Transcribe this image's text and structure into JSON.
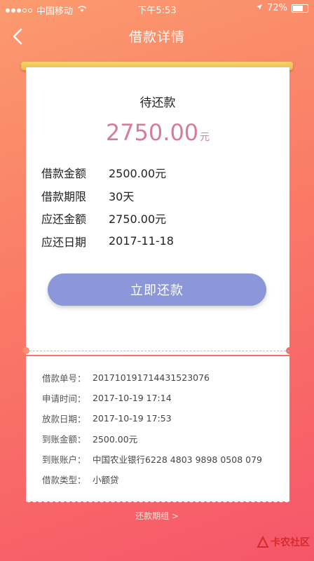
{
  "status_bar": {
    "carrier": "中国移动",
    "time": "下午5:53",
    "battery": "72%"
  },
  "nav": {
    "title": "借款详情"
  },
  "loan": {
    "status": "待还款",
    "amount": "2750.00",
    "amount_unit": "元",
    "rows": [
      {
        "label": "借款金额",
        "value": "2500.00元"
      },
      {
        "label": "借款期限",
        "value": "30天"
      },
      {
        "label": "应还金额",
        "value": "2750.00元"
      },
      {
        "label": "应还日期",
        "value": "2017-11-18"
      }
    ],
    "repay_button": "立即还款"
  },
  "details": [
    {
      "label": "借款单号：",
      "value": "201710191714431523076"
    },
    {
      "label": "申请时间：",
      "value": "2017-10-19 17:14"
    },
    {
      "label": "放款日期：",
      "value": "2017-10-19 17:53"
    },
    {
      "label": "到账金额：",
      "value": "2500.00元"
    },
    {
      "label": "到账账户：",
      "value": "中国农业银行6228 4803 9898 0508 079"
    },
    {
      "label": "借款类型：",
      "value": "小额贷"
    }
  ],
  "footer": {
    "plan_link": "还款期组 >",
    "watermark": "卡农社区"
  },
  "colors": {
    "accent_button": "#8b97d8",
    "amount_text": "#d47f98",
    "slot": "#e9b94a"
  }
}
